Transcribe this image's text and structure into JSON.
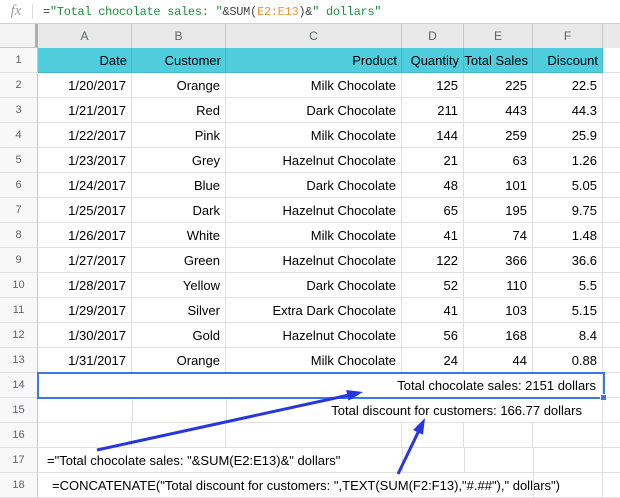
{
  "formula_bar": {
    "fx": "fx",
    "formula_segments": [
      {
        "text": "=",
        "color": "#454545"
      },
      {
        "text": "\"Total chocolate sales: \"",
        "color": "#1e8e3e"
      },
      {
        "text": "&SUM(",
        "color": "#454545"
      },
      {
        "text": "E2:E13",
        "color": "#ef9432"
      },
      {
        "text": ")&",
        "color": "#454545"
      },
      {
        "text": "\" dollars\"",
        "color": "#1e8e3e"
      }
    ]
  },
  "column_headers": [
    "A",
    "B",
    "C",
    "D",
    "E",
    "F"
  ],
  "row_numbers": [
    "1",
    "2",
    "3",
    "4",
    "5",
    "6",
    "7",
    "8",
    "9",
    "10",
    "11",
    "12",
    "13",
    "14",
    "15",
    "16",
    "17",
    "18"
  ],
  "sheet": {
    "header_row": [
      "Date",
      "Customer",
      "Product",
      "Quantity",
      "Total Sales",
      "Discount"
    ],
    "data_rows": [
      [
        "1/20/2017",
        "Orange",
        "Milk Chocolate",
        "125",
        "225",
        "22.5"
      ],
      [
        "1/21/2017",
        "Red",
        "Dark Chocolate",
        "211",
        "443",
        "44.3"
      ],
      [
        "1/22/2017",
        "Pink",
        "Milk Chocolate",
        "144",
        "259",
        "25.9"
      ],
      [
        "1/23/2017",
        "Grey",
        "Hazelnut Chocolate",
        "21",
        "63",
        "1.26"
      ],
      [
        "1/24/2017",
        "Blue",
        "Dark Chocolate",
        "48",
        "101",
        "5.05"
      ],
      [
        "1/25/2017",
        "Dark",
        "Hazelnut Chocolate",
        "65",
        "195",
        "9.75"
      ],
      [
        "1/26/2017",
        "White",
        "Milk Chocolate",
        "41",
        "74",
        "1.48"
      ],
      [
        "1/27/2017",
        "Green",
        "Hazelnut Chocolate",
        "122",
        "366",
        "36.6"
      ],
      [
        "1/28/2017",
        "Yellow",
        "Dark Chocolate",
        "52",
        "110",
        "5.5"
      ],
      [
        "1/29/2017",
        "Silver",
        "Extra Dark Chocolate",
        "41",
        "103",
        "5.15"
      ],
      [
        "1/30/2017",
        "Gold",
        "Hazelnut Chocolate",
        "56",
        "168",
        "8.4"
      ],
      [
        "1/31/2017",
        "Orange",
        "Milk Chocolate",
        "24",
        "44",
        "0.88"
      ]
    ],
    "row14_text": "Total chocolate sales: 2151 dollars",
    "row15_text": "Total discount for customers: 166.77 dollars",
    "row17_text": "=\"Total chocolate sales: \"&SUM(E2:E13)&\" dollars\"",
    "row18_text": "=CONCATENATE(\"Total discount for customers: \",TEXT(SUM(F2:F13),\"#.##\"),\" dollars\")"
  },
  "colors": {
    "header_fill": "#50cddc",
    "selection": "#3b78e7",
    "arrow": "#2836df",
    "formula_string_green": "#1e8e3e",
    "formula_range_orange": "#ef9432"
  }
}
